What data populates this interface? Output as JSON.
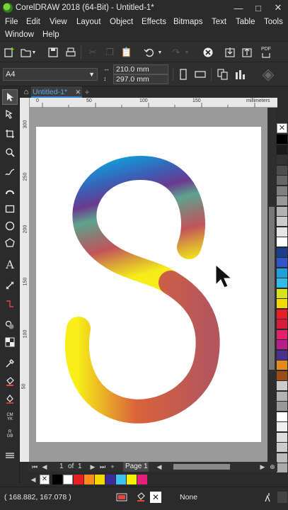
{
  "window": {
    "title": "CorelDRAW 2018 (64-Bit) - Untitled-1*",
    "buttons": [
      "—",
      "□",
      "✕"
    ]
  },
  "menu": {
    "row1": [
      "File",
      "Edit",
      "View",
      "Layout",
      "Object",
      "Effects",
      "Bitmaps",
      "Text",
      "Table",
      "Tools"
    ],
    "row2": [
      "Window",
      "Help"
    ]
  },
  "property_bar": {
    "page_size": "A4",
    "width": "210.0 mm",
    "height": "297.0 mm"
  },
  "document_tab": {
    "label": "Untitled-1*",
    "close": "✕",
    "add": "+"
  },
  "rulers": {
    "h_labels": [
      "0",
      "50",
      "100",
      "150"
    ],
    "v_labels": [
      "300",
      "250",
      "200",
      "150",
      "100",
      "50"
    ],
    "units": "millimeters"
  },
  "pager": {
    "current": "1",
    "of_label": "of",
    "total": "1",
    "page_tab": "Page 1"
  },
  "status": {
    "coords": "( 168.882, 167.078 )",
    "fill_label": "None"
  },
  "palette_colors": [
    "#000000",
    "#1a1a1a",
    "#333333",
    "#4d4d4d",
    "#666666",
    "#808080",
    "#999999",
    "#b3b3b3",
    "#cccccc",
    "#e6e6e6",
    "#ffffff",
    "#1e3c8c",
    "#2e55c9",
    "#1fa0d8",
    "#33bde6",
    "#d6e21c",
    "#f5d800",
    "#e81e25",
    "#d81a3c",
    "#e4206b",
    "#b41f8a",
    "#4b2f8e",
    "#e38b1d",
    "#9a4d1c",
    "#cccccc",
    "#b3b3b3",
    "#999999",
    "#ffffff",
    "#f0f0f0",
    "#dddddd",
    "#cccccc",
    "#bbbbbb",
    "#aaaaaa"
  ],
  "doc_palette_colors": [
    "#000000",
    "#ffffff",
    "#e81e25",
    "#ff8c1a",
    "#f5d800",
    "#3a2d99",
    "#3ec1ef",
    "#f5ef00",
    "#e4207c"
  ],
  "icons": {
    "new": "new-document-icon",
    "open": "open-folder-icon",
    "save": "save-icon",
    "print": "print-icon",
    "undo": "undo-icon",
    "import": "import-icon",
    "export": "export-icon",
    "pdf": "publish-pdf-icon"
  },
  "labels": {
    "pdf": "PDF"
  }
}
